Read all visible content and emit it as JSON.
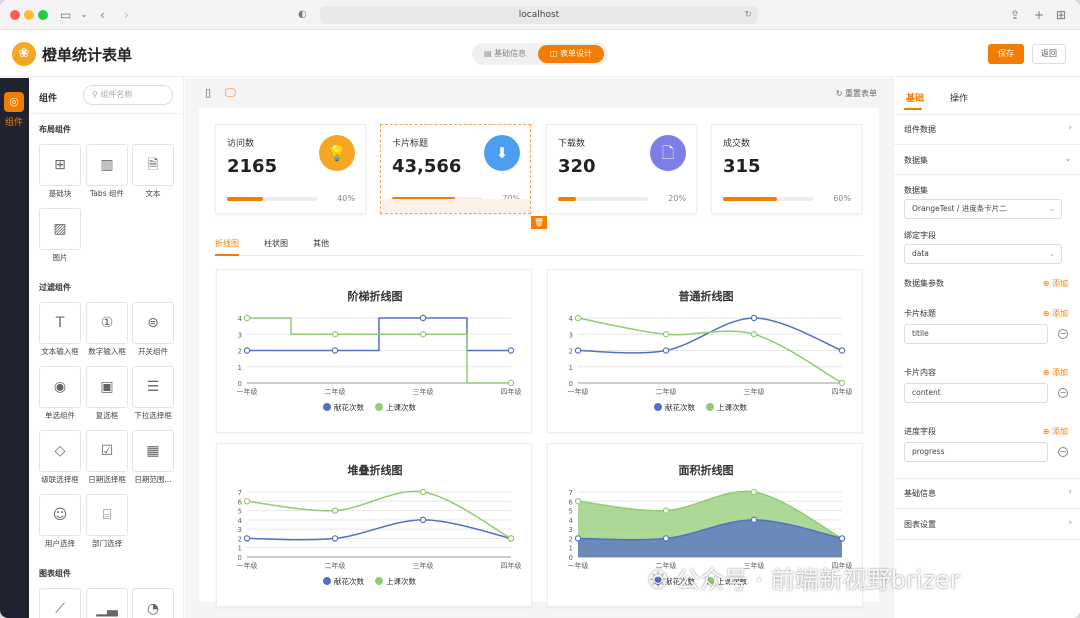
{
  "browser": {
    "url": "localhost"
  },
  "app": {
    "title": "橙单统计表单",
    "logo": "orange-logo"
  },
  "top_tabs": [
    {
      "label": "基础信息",
      "active": false
    },
    {
      "label": "表单设计",
      "active": true
    }
  ],
  "header_buttons": {
    "save": "保存",
    "back": "返回"
  },
  "rail": {
    "label": "组件"
  },
  "left_panel": {
    "title": "组件",
    "search_placeholder": "组件名称",
    "sections": [
      {
        "title": "布局组件",
        "items": [
          "基础块",
          "Tabs 组件",
          "文本",
          "图片"
        ]
      },
      {
        "title": "过滤组件",
        "items": [
          "文本输入框",
          "数字输入框",
          "开关组件",
          "单选组件",
          "复选框",
          "下拉选择框",
          "级联选择框",
          "日期选择框",
          "日期范围...",
          "用户选择",
          "部门选择"
        ]
      },
      {
        "title": "图表组件",
        "items": []
      }
    ]
  },
  "canvas": {
    "reset": "重置表单",
    "delete_icon": "trash-icon"
  },
  "cards": [
    {
      "title": "访问数",
      "value": "2165",
      "percent": "40%",
      "progress": 0.4,
      "icon": "bulb-icon",
      "color": "#f5a623"
    },
    {
      "title": "卡片标题",
      "value": "43,566",
      "percent": "70%",
      "progress": 0.7,
      "icon": "download-icon",
      "color": "#4c9ff0"
    },
    {
      "title": "下载数",
      "value": "320",
      "percent": "20%",
      "progress": 0.2,
      "icon": "file-icon",
      "color": "#7b7fe6"
    },
    {
      "title": "成交数",
      "value": "315",
      "percent": "60%",
      "progress": 0.6,
      "icon": "",
      "color": "#f47c00"
    }
  ],
  "chart_tabs": [
    {
      "label": "折线图",
      "active": true
    },
    {
      "label": "柱状图",
      "active": false
    },
    {
      "label": "其他",
      "active": false
    }
  ],
  "chart_data": [
    {
      "type": "line",
      "title": "阶梯折线图",
      "x": [
        "一年级",
        "二年级",
        "三年级",
        "四年级"
      ],
      "ylim": [
        0,
        4
      ],
      "yticks": [
        0,
        1,
        2,
        3,
        4
      ],
      "series": [
        {
          "name": "献花次数",
          "color": "#5470c6",
          "values": [
            2,
            2,
            4,
            2
          ]
        },
        {
          "name": "上课次数",
          "color": "#91cc75",
          "values": [
            4,
            3,
            3,
            0
          ]
        }
      ]
    },
    {
      "type": "line",
      "title": "普通折线图",
      "x": [
        "一年级",
        "二年级",
        "三年级",
        "四年级"
      ],
      "ylim": [
        0,
        4
      ],
      "yticks": [
        0,
        1,
        2,
        3,
        4
      ],
      "series": [
        {
          "name": "献花次数",
          "color": "#5470c6",
          "values": [
            2,
            2,
            4,
            2
          ]
        },
        {
          "name": "上课次数",
          "color": "#91cc75",
          "values": [
            4,
            3,
            3,
            0
          ]
        }
      ]
    },
    {
      "type": "line",
      "title": "堆叠折线图",
      "x": [
        "一年级",
        "二年级",
        "三年级",
        "四年级"
      ],
      "ylim": [
        0,
        7
      ],
      "yticks": [
        0,
        1,
        2,
        3,
        4,
        5,
        6,
        7
      ],
      "series": [
        {
          "name": "献花次数",
          "color": "#5470c6",
          "values": [
            2,
            2,
            4,
            2
          ]
        },
        {
          "name": "上课次数",
          "color": "#91cc75",
          "values": [
            6,
            5,
            7,
            2
          ]
        }
      ]
    },
    {
      "type": "area",
      "title": "面积折线图",
      "x": [
        "一年级",
        "二年级",
        "三年级",
        "四年级"
      ],
      "ylim": [
        0,
        7
      ],
      "yticks": [
        0,
        1,
        2,
        3,
        4,
        5,
        6,
        7
      ],
      "series": [
        {
          "name": "献花次数",
          "color": "#5470c6",
          "values": [
            2,
            2,
            4,
            2
          ]
        },
        {
          "name": "上课次数",
          "color": "#91cc75",
          "values": [
            6,
            5,
            7,
            2
          ]
        }
      ]
    }
  ],
  "right_panel": {
    "tabs": [
      {
        "label": "基础",
        "active": true
      },
      {
        "label": "操作",
        "active": false
      }
    ],
    "component_data": "组件数据",
    "dataset_section": "数据集",
    "dataset_label": "数据集",
    "dataset_value": "OrangeTest / 进度条卡片二",
    "bind_label": "绑定字段",
    "bind_value": "data",
    "params_label": "数据集参数",
    "add": "添加",
    "card_title_label": "卡片标题",
    "card_title_value": "titlle",
    "card_content_label": "卡片内容",
    "card_content_value": "content",
    "progress_label": "进度字段",
    "progress_value": "progress",
    "basic_info": "基础信息",
    "chart_settings": "图表设置"
  },
  "watermark": "公众号 · 前端新视野brizer"
}
